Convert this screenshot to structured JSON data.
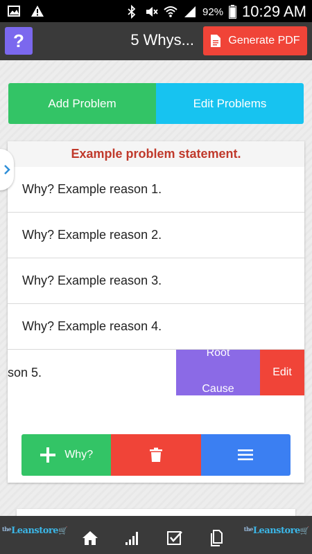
{
  "status_bar": {
    "battery": "92%",
    "time": "10:29 AM"
  },
  "header": {
    "help_label": "?",
    "title": "5 Whys...",
    "pdf_label": "Generate PDF"
  },
  "tabs": {
    "add": "Add Problem",
    "edit": "Edit Problems"
  },
  "problem": {
    "statement": "Example problem statement.",
    "reasons": [
      "Why? Example reason 1.",
      "Why? Example reason 2.",
      "Why? Example reason 3.",
      "Why? Example reason 4."
    ],
    "swiped_reason_fragment": "son 5.",
    "swipe_actions": {
      "root_top": "Root",
      "root_bottom": "Cause",
      "edit": "Edit"
    }
  },
  "actions": {
    "why_label": "Why?"
  },
  "footer": {
    "logo_prefix": "the",
    "logo_name": "Leanstore"
  },
  "colors": {
    "help": "#7b68ee",
    "pdf": "#f04438",
    "add": "#33c466",
    "edit": "#17c3f0",
    "statement": "#c0392b",
    "root_cause": "#8b6ae6",
    "delete": "#f04438",
    "menu": "#3b7ff2"
  }
}
